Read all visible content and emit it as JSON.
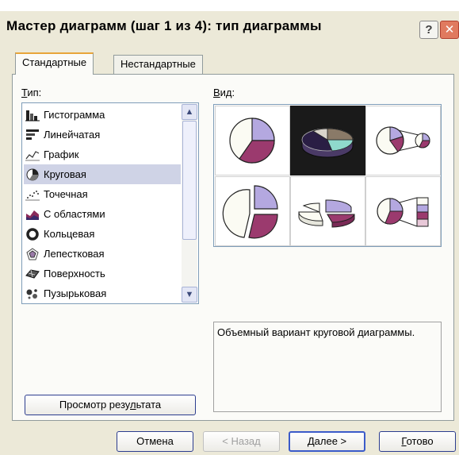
{
  "window": {
    "title": "Мастер диаграмм (шаг 1 из 4): тип диаграммы",
    "help_label": "?",
    "close_label": "✕"
  },
  "tabs": [
    {
      "label": "Стандартные",
      "active": true
    },
    {
      "label": "Нестандартные",
      "active": false
    }
  ],
  "type_section": {
    "label_prefix": "Т",
    "label_rest": "ип:",
    "items": [
      {
        "label": "Гистограмма",
        "icon": "column-chart-icon"
      },
      {
        "label": "Линейчатая",
        "icon": "bar-chart-icon"
      },
      {
        "label": "График",
        "icon": "line-chart-icon"
      },
      {
        "label": "Круговая",
        "icon": "pie-chart-icon",
        "selected": true
      },
      {
        "label": "Точечная",
        "icon": "scatter-chart-icon"
      },
      {
        "label": "С областями",
        "icon": "area-chart-icon"
      },
      {
        "label": "Кольцевая",
        "icon": "doughnut-chart-icon"
      },
      {
        "label": "Лепестковая",
        "icon": "radar-chart-icon"
      },
      {
        "label": "Поверхность",
        "icon": "surface-chart-icon"
      },
      {
        "label": "Пузырьковая",
        "icon": "bubble-chart-icon"
      }
    ],
    "scroll_up": "▲",
    "scroll_down": "▼"
  },
  "subtype_section": {
    "label_prefix": "В",
    "label_rest": "ид:",
    "selected_index": 1
  },
  "description": "Объемный вариант круговой диаграммы.",
  "preview_button": {
    "prefix": "Просмотр резу",
    "underlined": "л",
    "suffix": "ьтата"
  },
  "buttons": {
    "cancel": "Отмена",
    "back": "< Назад",
    "next_underlined": "Д",
    "next_rest": "алее >",
    "finish_underlined": "Г",
    "finish_rest": "отово"
  },
  "colors": {
    "pie_cream": "#fbfbf3",
    "pie_lavender": "#b4a8e0",
    "pie_plum": "#9b3a6e",
    "pie3d_dark": "#2a1e44",
    "pie3d_teal": "#8fd9cc",
    "pie3d_brown": "#8a7a68",
    "pie3d_gray": "#d9d4cc"
  }
}
